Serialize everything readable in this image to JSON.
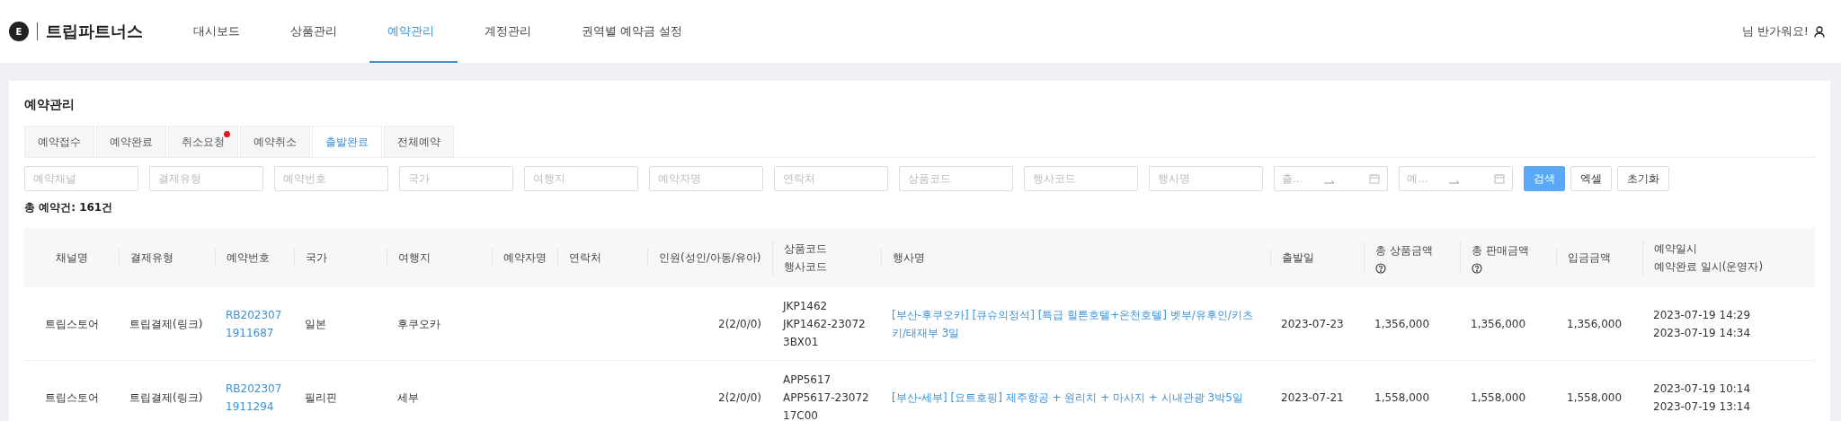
{
  "header": {
    "logo_letter": "E",
    "brand": "트립파트너스",
    "nav": [
      {
        "label": "대시보드",
        "selected": false
      },
      {
        "label": "상품관리",
        "selected": false
      },
      {
        "label": "예약관리",
        "selected": true
      },
      {
        "label": "계정관리",
        "selected": false
      },
      {
        "label": "권역별 예약금 설정",
        "selected": false
      }
    ],
    "greeting": "님 반가워요!"
  },
  "page_title": "예약관리",
  "tabs": [
    {
      "label": "예약접수",
      "selected": false,
      "notification": false
    },
    {
      "label": "예약완료",
      "selected": false,
      "notification": false
    },
    {
      "label": "취소요청",
      "selected": false,
      "notification": true
    },
    {
      "label": "예약취소",
      "selected": false,
      "notification": false
    },
    {
      "label": "출발완료",
      "selected": true,
      "notification": false
    },
    {
      "label": "전체예약",
      "selected": false,
      "notification": false
    }
  ],
  "filters": [
    {
      "kind": "text",
      "placeholder": "예약채널"
    },
    {
      "kind": "text",
      "placeholder": "결제유형"
    },
    {
      "kind": "text",
      "placeholder": "예약번호"
    },
    {
      "kind": "text",
      "placeholder": "국가"
    },
    {
      "kind": "text",
      "placeholder": "여행지"
    },
    {
      "kind": "text",
      "placeholder": "예약자명"
    },
    {
      "kind": "text",
      "placeholder": "연락처"
    },
    {
      "kind": "text",
      "placeholder": "상품코드"
    },
    {
      "kind": "text",
      "placeholder": "행사코드"
    },
    {
      "kind": "text",
      "placeholder": "행사명"
    },
    {
      "kind": "date_range",
      "placeholder": "출..."
    },
    {
      "kind": "date_range",
      "placeholder": "예..."
    }
  ],
  "buttons": [
    {
      "label": "검색",
      "primary": true
    },
    {
      "label": "엑셀",
      "primary": false
    },
    {
      "label": "초기화",
      "primary": false
    }
  ],
  "total": "총 예약건: 161건",
  "table": {
    "columns": [
      {
        "lines": [
          "채널명"
        ],
        "help": false
      },
      {
        "lines": [
          "결제유형"
        ],
        "help": false
      },
      {
        "lines": [
          "예약번호"
        ],
        "help": false
      },
      {
        "lines": [
          "국가"
        ],
        "help": false
      },
      {
        "lines": [
          "여행지"
        ],
        "help": false
      },
      {
        "lines": [
          "예약자명"
        ],
        "help": false
      },
      {
        "lines": [
          "연락처"
        ],
        "help": false
      },
      {
        "lines": [
          "인원(성인/아동/유아)"
        ],
        "help": false
      },
      {
        "lines": [
          "상품코드",
          "행사코드"
        ],
        "help": false
      },
      {
        "lines": [
          "행사명"
        ],
        "help": false
      },
      {
        "lines": [
          "출발일"
        ],
        "help": false
      },
      {
        "lines": [
          "총 상품금액"
        ],
        "help": true
      },
      {
        "lines": [
          "총 판매금액"
        ],
        "help": true
      },
      {
        "lines": [
          "입금금액"
        ],
        "help": false
      },
      {
        "lines": [
          "예약일시",
          "예약완료 일시(운영자)"
        ],
        "help": false
      }
    ],
    "rows": [
      {
        "channel": "트립스토어",
        "payment_type": "트립결제(링크)",
        "booking_no": "RB2023071911687",
        "country": "일본",
        "destination": "후쿠오카",
        "people": "2(2/0/0)",
        "codes": [
          "JKP1462",
          "JKP1462-230723BX01"
        ],
        "tour_name": "[부산-후쿠오카] [큐슈의정석] [특급 힐튼호텔+온천호텔] 벳부/유후인/키츠키/태재부 3일",
        "departure": "2023-07-23",
        "total_product": "1,356,000",
        "total_sale": "1,356,000",
        "deposit": "1,356,000",
        "times": [
          "2023-07-19 14:29",
          "2023-07-19 14:34"
        ]
      },
      {
        "channel": "트립스토어",
        "payment_type": "트립결제(링크)",
        "booking_no": "RB2023071911294",
        "country": "필리핀",
        "destination": "세부",
        "people": "2(2/0/0)",
        "codes": [
          "APP5617",
          "APP5617-2307217C00"
        ],
        "tour_name": "[부산-세부] [요트호핑] 제주항공 + 원리치 + 마사지 + 시내관광 3박5일",
        "departure": "2023-07-21",
        "total_product": "1,558,000",
        "total_sale": "1,558,000",
        "deposit": "1,558,000",
        "times": [
          "2023-07-19 10:14",
          "2023-07-19 13:14"
        ]
      }
    ]
  }
}
